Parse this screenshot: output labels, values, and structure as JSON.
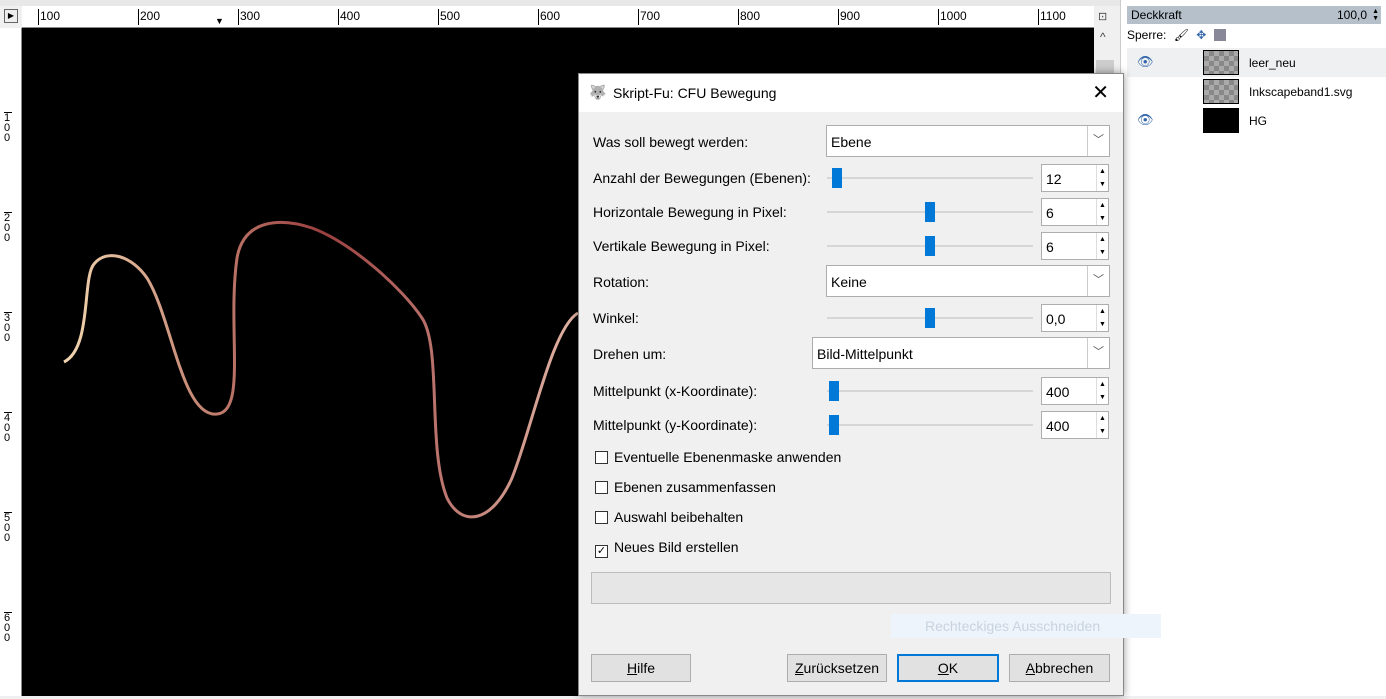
{
  "rulers": {
    "top": [
      "100",
      "200",
      "300",
      "400",
      "500",
      "600",
      "700",
      "800",
      "900",
      "1000",
      "1100"
    ],
    "left": [
      "100",
      "200",
      "300",
      "400",
      "500",
      "600"
    ]
  },
  "layers_panel": {
    "opacity_label": "Deckkraft",
    "opacity_value": "100,0",
    "lock_label": "Sperre:",
    "layers": [
      {
        "name": "leer_neu",
        "visible": true,
        "selected": true
      },
      {
        "name": "Inkscapeband1.svg",
        "visible": false,
        "selected": false
      },
      {
        "name": "HG",
        "visible": true,
        "selected": false
      }
    ]
  },
  "dialog": {
    "title": "Skript-Fu: CFU Bewegung",
    "fields": {
      "what_label": "Was soll bewegt werden:",
      "what_value": "Ebene",
      "count_label": "Anzahl der Bewegungen (Ebenen):",
      "count_value": "12",
      "hmove_label": "Horizontale Bewegung in Pixel:",
      "hmove_value": "6",
      "vmove_label": "Vertikale Bewegung in Pixel:",
      "vmove_value": "6",
      "rotation_label": "Rotation:",
      "rotation_value": "Keine",
      "angle_label": "Winkel:",
      "angle_value": "0,0",
      "rotate_around_label": "Drehen um:",
      "rotate_around_value": "Bild-Mittelpunkt",
      "cx_label": "Mittelpunkt (x-Koordinate):",
      "cx_value": "400",
      "cy_label": "Mittelpunkt (y-Koordinate):",
      "cy_value": "400"
    },
    "checkboxes": [
      {
        "label": "Eventuelle Ebenenmaske anwenden",
        "checked": false
      },
      {
        "label": "Ebenen zusammenfassen",
        "checked": false
      },
      {
        "label": "Auswahl beibehalten",
        "checked": false
      },
      {
        "label": "Neues Bild erstellen",
        "checked": true
      }
    ],
    "tooltip": "Rechteckiges Ausschneiden",
    "buttons": {
      "help_h": "H",
      "help_rest": "ilfe",
      "reset_z": "Z",
      "reset_rest": "urücksetzen",
      "ok_o": "O",
      "ok_rest": "K",
      "cancel_a": "A",
      "cancel_rest": "bbrechen"
    }
  }
}
